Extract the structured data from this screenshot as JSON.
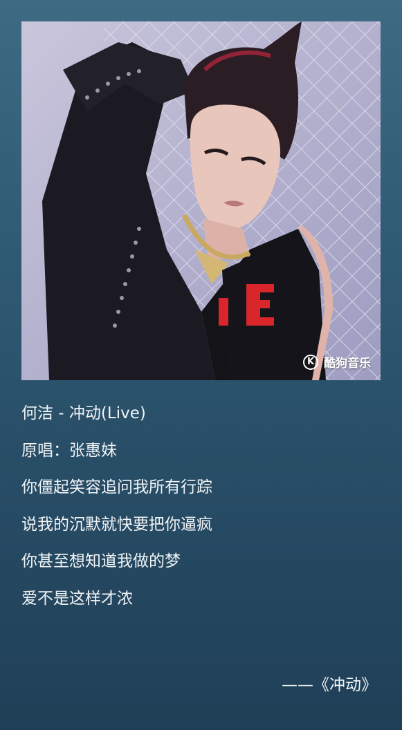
{
  "cover": {
    "brand_text": "酷狗音乐",
    "brand_icon_letter": "K",
    "image_description_icon": "album-cover-image"
  },
  "song": {
    "title_line": "何洁 - 冲动(Live)",
    "original_singer_line": "原唱：张惠妹"
  },
  "lyrics": [
    "你僵起笑容追问我所有行踪",
    "说我的沉默就快要把你逼疯",
    "你甚至想知道我做的梦",
    "爱不是这样才浓"
  ],
  "source_line": "——《冲动》",
  "colors": {
    "background_top": "#3f6a83",
    "background_bottom": "#1f3f57",
    "text": "#f1f4f6"
  }
}
